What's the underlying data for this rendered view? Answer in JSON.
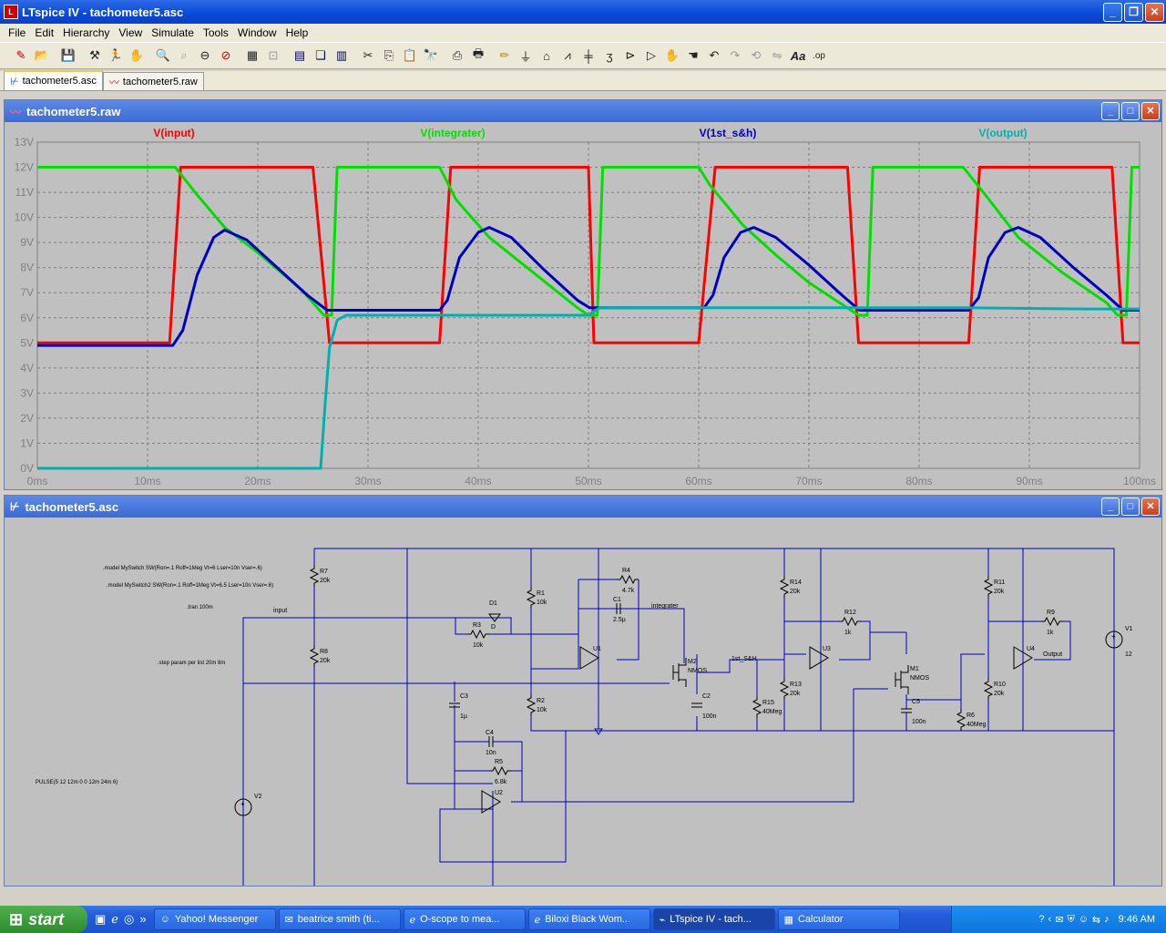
{
  "window": {
    "title": "LTspice IV - tachometer5.asc"
  },
  "menu": [
    "File",
    "Edit",
    "Hierarchy",
    "View",
    "Simulate",
    "Tools",
    "Window",
    "Help"
  ],
  "toolbar_icons": [
    "new-schematic-icon",
    "open-icon",
    "save-icon",
    "control-panel-icon",
    "run-icon",
    "halt-icon",
    "zoom-in-icon",
    "zoom-area-icon",
    "zoom-out-icon",
    "zoom-cancel-icon",
    "autorange-icon",
    "zoom-full-icon",
    "tile-horizontal-icon",
    "cascade-icon",
    "tile-vertical-icon",
    "cut-icon",
    "copy-icon",
    "paste-icon",
    "find-icon",
    "print-setup-icon",
    "print-icon",
    "wire-icon",
    "ground-icon",
    "label-icon",
    "resistor-icon",
    "capacitor-icon",
    "inductor-icon",
    "diode-icon",
    "component-icon",
    "move-icon",
    "drag-icon",
    "undo-icon",
    "redo-icon",
    "rotate-icon",
    "mirror-icon",
    "text-icon",
    "spice-directive-icon"
  ],
  "tabs": [
    {
      "label": "tachometer5.asc"
    },
    {
      "label": "tachometer5.raw"
    }
  ],
  "wave_window": {
    "title": "tachometer5.raw"
  },
  "schematic_window": {
    "title": "tachometer5.asc"
  },
  "chart_data": {
    "type": "line",
    "xlabel": "",
    "ylabel": "",
    "xlim": [
      0,
      100
    ],
    "ylim": [
      0,
      13
    ],
    "xticks": [
      "0ms",
      "10ms",
      "20ms",
      "30ms",
      "40ms",
      "50ms",
      "60ms",
      "70ms",
      "80ms",
      "90ms",
      "100ms"
    ],
    "yticks": [
      "0V",
      "1V",
      "2V",
      "3V",
      "4V",
      "5V",
      "6V",
      "7V",
      "8V",
      "9V",
      "10V",
      "11V",
      "12V",
      "13V"
    ],
    "grid": true,
    "colors": {
      "input": "#ff0000",
      "integrater": "#00e000",
      "s_h": "#0000c0",
      "output": "#00b0b0"
    },
    "series": [
      {
        "name": "V(input)",
        "x": [
          0,
          12,
          13,
          25,
          26.5,
          36.5,
          37.5,
          50,
          50.5,
          60,
          61.5,
          73.5,
          74.5,
          84.5,
          85.5,
          97.5,
          98.5,
          100
        ],
        "y": [
          5,
          5,
          12,
          12,
          5,
          5,
          12,
          12,
          5,
          5,
          12,
          12,
          5,
          5,
          12,
          12,
          5,
          5
        ]
      },
      {
        "name": "V(integrater)",
        "x": [
          0,
          12.5,
          14.5,
          17,
          20,
          24,
          26,
          26.7,
          27.2,
          36.5,
          38,
          41,
          45,
          49,
          50,
          50.8,
          51.3,
          60,
          61,
          64,
          67,
          70,
          74.5,
          75.3,
          75.8,
          84,
          86,
          89,
          93,
          97,
          98,
          98.8,
          99.3,
          100
        ],
        "y": [
          12,
          12,
          10.9,
          9.6,
          8.6,
          7.1,
          6.1,
          6.1,
          12,
          12,
          10.7,
          9.2,
          7.8,
          6.4,
          6.1,
          6.1,
          12,
          12,
          11.3,
          9.7,
          8.5,
          7.4,
          6.1,
          6.1,
          12,
          12,
          10.9,
          9.2,
          7.8,
          6.6,
          6.1,
          6.1,
          12,
          12
        ]
      },
      {
        "name": "V(1st_s&h)",
        "x": [
          0,
          12.3,
          13.2,
          14.5,
          16,
          17,
          19,
          22,
          24.5,
          26.3,
          36.5,
          37.2,
          38.3,
          40,
          41,
          43,
          46,
          49,
          50.1,
          60.5,
          61.3,
          62.3,
          63.8,
          65,
          67,
          70,
          73,
          74.6,
          84.5,
          85.4,
          86.3,
          87.8,
          89,
          91,
          94,
          97,
          98.5,
          100
        ],
        "y": [
          4.9,
          4.9,
          5.5,
          7.7,
          9.2,
          9.5,
          9.1,
          7.9,
          6.9,
          6.3,
          6.3,
          6.7,
          8.4,
          9.4,
          9.6,
          9.2,
          7.9,
          6.7,
          6.4,
          6.4,
          6.9,
          8.4,
          9.4,
          9.6,
          9.2,
          8.1,
          6.9,
          6.3,
          6.3,
          6.8,
          8.4,
          9.4,
          9.6,
          9.2,
          8.0,
          6.9,
          6.3,
          6.3
        ]
      },
      {
        "name": "V(output)",
        "x": [
          0,
          25.7,
          26.1,
          26.5,
          27.2,
          28,
          36,
          50,
          51,
          60,
          74,
          84,
          95,
          100
        ],
        "y": [
          0,
          0,
          2.5,
          4.8,
          5.9,
          6.1,
          6.1,
          6.1,
          6.4,
          6.4,
          6.4,
          6.4,
          6.35,
          6.35
        ]
      }
    ]
  },
  "schematic": {
    "directives": [
      ".model MySwitch SW(Ron=.1 Roff=1Meg Vt=6 Lser=10n Vser=.6)",
      ".model MySwitch2 SW(Ron=.1 Roff=1Meg Vt=6.5 Lser=10n Vser=.6)",
      ".tran 100m",
      ".step param per list 20m 8m",
      "PULSE(5 12 12m 0 0 12m 24m 6)"
    ],
    "nets": [
      "input",
      "integrater",
      "1st_S&H",
      "Output"
    ],
    "components": [
      {
        "ref": "R7",
        "val": "20k"
      },
      {
        "ref": "R8",
        "val": "20k"
      },
      {
        "ref": "R1",
        "val": "10k"
      },
      {
        "ref": "R2",
        "val": "10k"
      },
      {
        "ref": "R3",
        "val": "10k"
      },
      {
        "ref": "D1",
        "val": "D"
      },
      {
        "ref": "R4",
        "val": "4.7k"
      },
      {
        "ref": "C1",
        "val": "2.5µ"
      },
      {
        "ref": "U1",
        "val": ""
      },
      {
        "ref": "M2",
        "val": "NMOS"
      },
      {
        "ref": "C2",
        "val": "100n"
      },
      {
        "ref": "R14",
        "val": "20k"
      },
      {
        "ref": "R12",
        "val": "1k"
      },
      {
        "ref": "U3",
        "val": ""
      },
      {
        "ref": "R13",
        "val": "20k"
      },
      {
        "ref": "R15",
        "val": "40Meg"
      },
      {
        "ref": "M1",
        "val": "NMOS"
      },
      {
        "ref": "C5",
        "val": "100n"
      },
      {
        "ref": "R6",
        "val": "40Meg"
      },
      {
        "ref": "R11",
        "val": "20k"
      },
      {
        "ref": "R9",
        "val": "1k"
      },
      {
        "ref": "U4",
        "val": ""
      },
      {
        "ref": "R10",
        "val": "20k"
      },
      {
        "ref": "V1",
        "val": "12"
      },
      {
        "ref": "C3",
        "val": "1µ"
      },
      {
        "ref": "C4",
        "val": "10n"
      },
      {
        "ref": "R5",
        "val": "6.8k"
      },
      {
        "ref": "U2",
        "val": ""
      },
      {
        "ref": "V2",
        "val": ""
      }
    ]
  },
  "taskbar": {
    "start": "start",
    "tasks": [
      "Yahoo! Messenger",
      "beatrice smith (ti...",
      "O-scope to mea...",
      "Biloxi Black Wom...",
      "LTspice IV - tach...",
      "Calculator"
    ],
    "clock": "9:46 AM"
  }
}
